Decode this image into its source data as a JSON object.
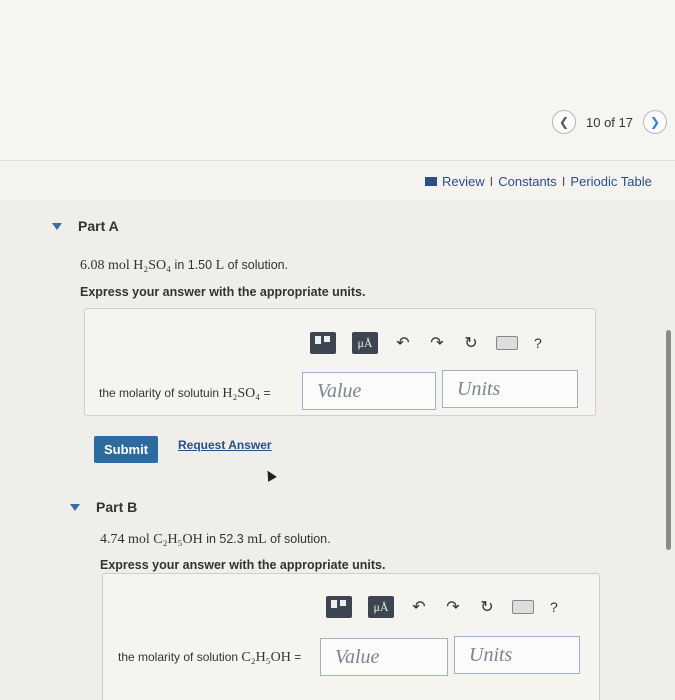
{
  "nav": {
    "prev_icon": "chevron-left-icon",
    "count": "10 of 17",
    "next_icon": "chevron-right-icon"
  },
  "links": {
    "review": "Review",
    "constants": "Constants",
    "periodic_table": "Periodic Table",
    "sep": "I"
  },
  "toolbar": {
    "mu": "μÅ",
    "help": "?"
  },
  "part_a": {
    "title": "Part A",
    "question_math1": "6.08 mol H₂SO₄",
    "question_text1": "in 1.50",
    "question_math2": "L",
    "question_text2": "of solution.",
    "express": "Express your answer with the appropriate units.",
    "label_text": "the molarity of solutuin",
    "label_math": "H₂SO₄",
    "label_eq": "=",
    "value_placeholder": "Value",
    "units_placeholder": "Units",
    "submit": "Submit",
    "request": "Request Answer"
  },
  "part_b": {
    "title": "Part B",
    "question_math1": "4.74 mol C₂H₅OH",
    "question_text1": "in 52.3",
    "question_math2": "mL",
    "question_text2": "of solution.",
    "express": "Express your answer with the appropriate units.",
    "label_text": "the molarity of solution",
    "label_math": "C₂H₅OH",
    "label_eq": "=",
    "value_placeholder": "Value",
    "units_placeholder": "Units"
  }
}
